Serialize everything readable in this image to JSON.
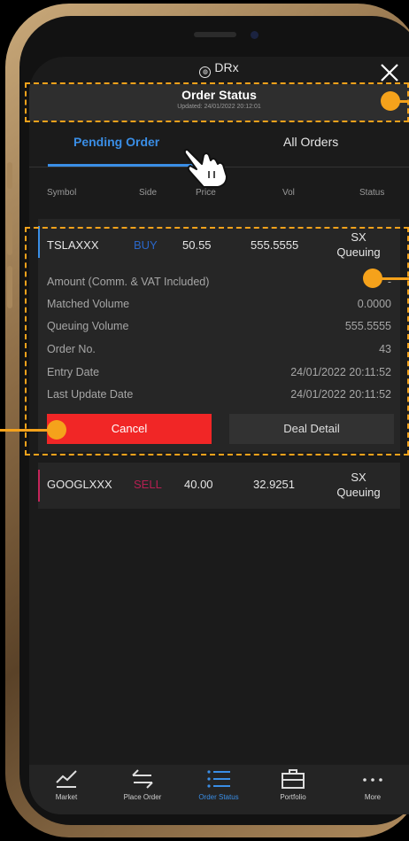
{
  "app": {
    "brand": "DRx",
    "brand_icon": "globe-icon"
  },
  "header": {
    "title": "Order Status",
    "updated": "Updated: 24/01/2022 20:12:01"
  },
  "tabs": [
    {
      "label": "Pending Order",
      "active": true
    },
    {
      "label": "All Orders",
      "active": false
    }
  ],
  "columns": {
    "symbol": "Symbol",
    "side": "Side",
    "price": "Price",
    "vol": "Vol",
    "status": "Status"
  },
  "orders": [
    {
      "symbol": "TSLAXXX",
      "side": "BUY",
      "price": "50.55",
      "vol": "555.5555",
      "status_market": "SX",
      "status": "Queuing",
      "accent_color": "#3a8ee6",
      "side_color": "#2a67c9",
      "details": [
        {
          "label": "Amount (Comm. & VAT Included)",
          "value": "-"
        },
        {
          "label": "Matched Volume",
          "value": "0.0000"
        },
        {
          "label": "Queuing Volume",
          "value": "555.5555"
        },
        {
          "label": "Order No.",
          "value": "43"
        },
        {
          "label": "Entry Date",
          "value": "24/01/2022 20:11:52"
        },
        {
          "label": "Last Update Date",
          "value": "24/01/2022 20:11:52"
        }
      ],
      "actions": {
        "cancel": "Cancel",
        "deal_detail": "Deal Detail"
      }
    },
    {
      "symbol": "GOOGLXXX",
      "side": "SELL",
      "price": "40.00",
      "vol": "32.9251",
      "status_market": "SX",
      "status": "Queuing",
      "accent_color": "#c4255a",
      "side_color": "#b61f52"
    }
  ],
  "nav": [
    {
      "label": "Market",
      "icon": "chart-icon"
    },
    {
      "label": "Place Order",
      "icon": "swap-arrows-icon"
    },
    {
      "label": "Order Status",
      "icon": "list-icon",
      "active": true
    },
    {
      "label": "Portfolio",
      "icon": "briefcase-icon"
    },
    {
      "label": "More",
      "icon": "more-dots-icon"
    }
  ],
  "colors": {
    "accent": "#3a8ee6",
    "cancel": "#f12626",
    "annotation": "#f5a21b",
    "buy": "#2a67c9",
    "sell": "#b61f52"
  }
}
